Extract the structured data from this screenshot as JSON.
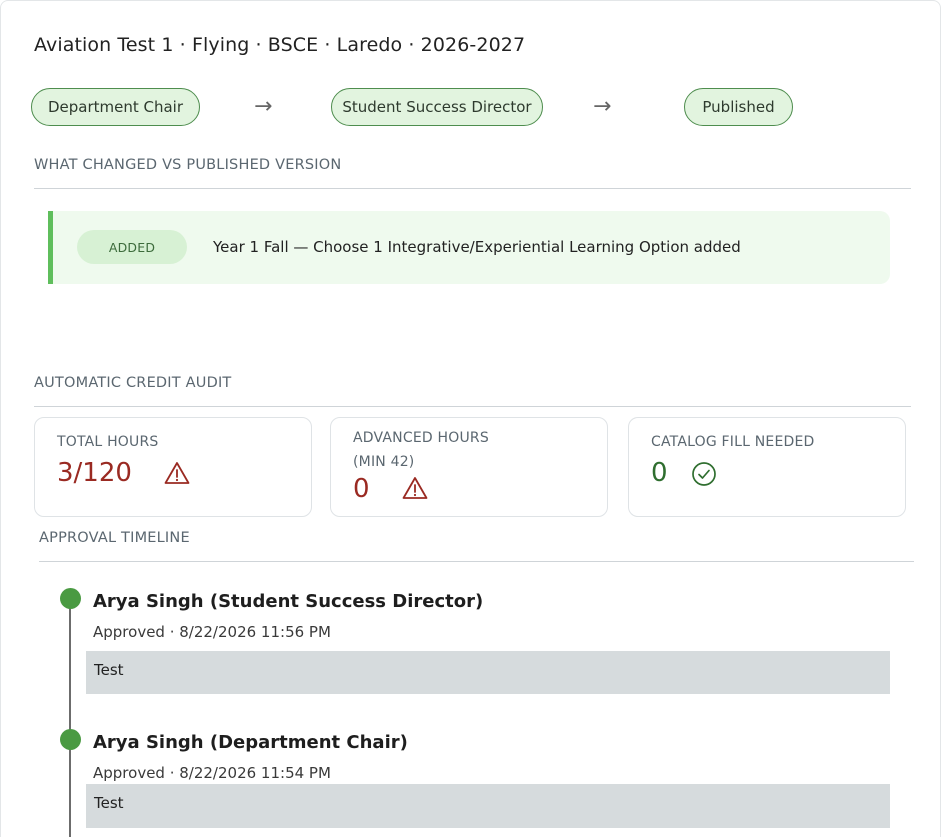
{
  "header": {
    "title": "Aviation Test 1 · Flying · BSCE · Laredo · 2026-2027"
  },
  "workflow": {
    "steps": [
      "Department Chair",
      "Student Success Director",
      "Published"
    ],
    "arrow": "→"
  },
  "changes": {
    "section_label": "WHAT CHANGED VS PUBLISHED VERSION",
    "items": [
      {
        "badge": "ADDED",
        "text": "Year 1 Fall — Choose 1 Integrative/Experiential Learning Option added"
      }
    ]
  },
  "audit": {
    "section_label": "AUTOMATIC CREDIT AUDIT",
    "cards": [
      {
        "label_line1": "TOTAL HOURS",
        "label_line2": "",
        "value": "3/120",
        "status": "warning"
      },
      {
        "label_line1": "ADVANCED HOURS",
        "label_line2": "(MIN 42)",
        "value": "0",
        "status": "warning"
      },
      {
        "label_line1": "CATALOG FILL NEEDED",
        "label_line2": "",
        "value": "0",
        "status": "ok"
      }
    ]
  },
  "timeline": {
    "section_label": "APPROVAL TIMELINE",
    "entries": [
      {
        "name": "Arya Singh (Student Success Director)",
        "meta": "Approved · 8/22/2026 11:56 PM",
        "note": "Test"
      },
      {
        "name": "Arya Singh (Department Chair)",
        "meta": "Approved · 8/22/2026 11:54 PM",
        "note": "Test"
      }
    ]
  },
  "colors": {
    "accent_green": "#5fbe5c",
    "pill_bg": "#e2f4df",
    "warning_red": "#9a2a22",
    "ok_green": "#2f6e2f",
    "timeline_dot": "#4a9a42"
  },
  "icons": {
    "warning": "warning-triangle-icon",
    "ok": "check-circle-icon",
    "arrow": "arrow-right-icon"
  }
}
